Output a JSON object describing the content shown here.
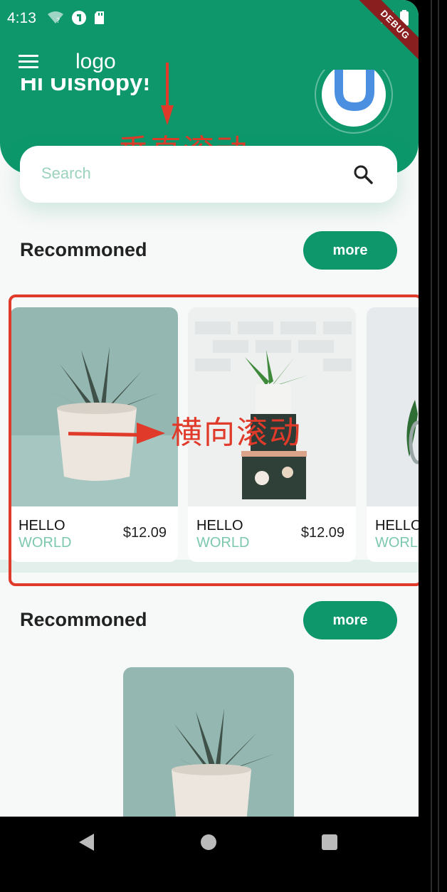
{
  "status_bar": {
    "time": "4:13"
  },
  "debug_banner": "DEBUG",
  "app_bar": {
    "logo": "logo"
  },
  "header": {
    "greeting": "Hi Uishopy!"
  },
  "search": {
    "placeholder": "Search"
  },
  "sections": [
    {
      "title": "Recommoned",
      "more_label": "more"
    },
    {
      "title": "Recommoned",
      "more_label": "more"
    }
  ],
  "products": [
    {
      "line1": "HELLO",
      "line2": "WORLD",
      "price": "$12.09"
    },
    {
      "line1": "HELLO",
      "line2": "WORLD",
      "price": "$12.09"
    },
    {
      "line1": "HELLO",
      "line2": "WORLD",
      "price": ""
    }
  ],
  "annotations": {
    "vertical_scroll": "垂直滚动",
    "horizontal_scroll": "横向滚动"
  },
  "colors": {
    "primary": "#0d976b",
    "accent_light": "#9bd3bd",
    "annotation": "#e03a2a"
  }
}
